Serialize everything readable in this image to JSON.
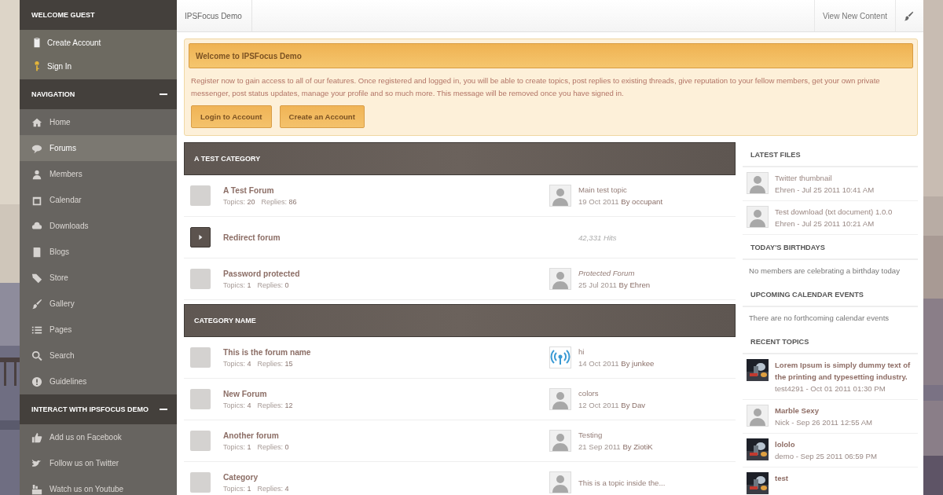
{
  "sidebar": {
    "sections": [
      {
        "title": "WELCOME GUEST",
        "items": [
          {
            "label": "Create Account",
            "selected": false
          },
          {
            "label": "Sign In",
            "selected": false
          }
        ]
      },
      {
        "title": "NAVIGATION",
        "expanded": true,
        "items": [
          {
            "label": "Home",
            "selected": false
          },
          {
            "label": "Forums",
            "selected": true
          },
          {
            "label": "Members",
            "selected": false
          },
          {
            "label": "Calendar",
            "selected": false
          },
          {
            "label": "Downloads",
            "selected": false
          },
          {
            "label": "Blogs",
            "selected": false
          },
          {
            "label": "Store",
            "selected": false
          },
          {
            "label": "Gallery",
            "selected": false
          },
          {
            "label": "Pages",
            "selected": false
          },
          {
            "label": "Search",
            "selected": false
          },
          {
            "label": "Guidelines",
            "selected": false
          }
        ]
      },
      {
        "title": "INTERACT WITH IPSFOCUS DEMO",
        "expanded": true,
        "items": [
          {
            "label": "Add us on Facebook",
            "selected": false
          },
          {
            "label": "Follow us on Twitter",
            "selected": false
          },
          {
            "label": "Watch us on Youtube",
            "selected": false
          }
        ]
      }
    ]
  },
  "top_bar": {
    "breadcrumb": "IPSFocus Demo",
    "link": "View New Content"
  },
  "notice": {
    "title": "Welcome to IPSFocus Demo",
    "text": "Register now to gain access to all of our features. Once registered and logged in, you will be able to create topics, post replies to existing threads, give reputation to your fellow members, get your own private messenger, post status updates, manage your profile and so much more. This message will be removed once you have signed in.",
    "buttons": [
      "Login to Account",
      "Create an Account"
    ]
  },
  "categories": [
    {
      "title": "A TEST CATEGORY",
      "forums": [
        {
          "kind": "forum",
          "name": "A Test Forum",
          "stats": [
            {
              "label": "Topics:",
              "value": "20"
            },
            {
              "label": "Replies:",
              "value": "86"
            }
          ],
          "last_post": {
            "kind": "normal",
            "avatar": {
              "kind": "default"
            },
            "title": "Main test topic",
            "date": "19 Oct 2011",
            "by": "By",
            "author": "occupant"
          }
        },
        {
          "kind": "redirect",
          "name": "Redirect forum",
          "hits": "42,331 Hits"
        },
        {
          "kind": "forum",
          "name": "Password protected",
          "stats": [
            {
              "label": "Topics:",
              "value": "1"
            },
            {
              "label": "Replies:",
              "value": "0"
            }
          ],
          "last_post": {
            "kind": "protected",
            "avatar": {
              "kind": "default"
            },
            "title": "Protected Forum",
            "date": "25 Jul 2011",
            "by": "By",
            "author": "Ehren"
          }
        }
      ]
    },
    {
      "title": "CATEGORY NAME",
      "forums": [
        {
          "kind": "forum",
          "name": "This is the forum name",
          "stats": [
            {
              "label": "Topics:",
              "value": "4"
            },
            {
              "label": "Replies:",
              "value": "15"
            }
          ],
          "last_post": {
            "kind": "normal",
            "avatar": {
              "kind": "broadcast"
            },
            "title": "hi",
            "date": "14 Oct 2011",
            "by": "By",
            "author": "junkee"
          }
        },
        {
          "kind": "forum",
          "name": "New Forum",
          "stats": [
            {
              "label": "Topics:",
              "value": "4"
            },
            {
              "label": "Replies:",
              "value": "12"
            }
          ],
          "last_post": {
            "kind": "normal",
            "avatar": {
              "kind": "default"
            },
            "title": "colors",
            "date": "12 Oct 2011",
            "by": "By",
            "author": "Dav"
          }
        },
        {
          "kind": "forum",
          "name": "Another forum",
          "stats": [
            {
              "label": "Topics:",
              "value": "1"
            },
            {
              "label": "Replies:",
              "value": "0"
            }
          ],
          "last_post": {
            "kind": "normal",
            "avatar": {
              "kind": "default"
            },
            "title": "Testing",
            "date": "21 Sep 2011",
            "by": "By",
            "author": "ZiotiK"
          }
        },
        {
          "kind": "forum",
          "name": "Category",
          "stats": [
            {
              "label": "Topics:",
              "value": "1"
            },
            {
              "label": "Replies:",
              "value": "4"
            }
          ],
          "last_post": {
            "kind": "normal",
            "avatar": {
              "kind": "default"
            },
            "title": "This is a topic inside the..."
          }
        }
      ]
    }
  ],
  "right_column": {
    "latest_files": {
      "title": "LATEST FILES",
      "items": [
        {
          "title": "Twitter thumbnail",
          "meta": "Ehren - Jul 25 2011 10:41 AM"
        },
        {
          "title": "Test download (txt document) 1.0.0",
          "meta": "Ehren - Jul 25 2011 10:21 AM"
        }
      ]
    },
    "birthdays": {
      "title": "TODAY'S BIRTHDAYS",
      "text": "No members are celebrating a birthday today"
    },
    "events": {
      "title": "UPCOMING CALENDAR EVENTS",
      "text": "There are no forthcoming calendar events"
    },
    "recent_topics": {
      "title": "RECENT TOPICS",
      "items": [
        {
          "title": "Lorem Ipsum is simply dummy text of the printing and typesetting industry.",
          "meta": "test4291 - Oct 01 2011 01:30 PM"
        },
        {
          "thumb": {
            "kind": "avatar"
          },
          "title": "Marble Sexy",
          "meta": "Nick - Sep 26 2011 12:55 AM"
        },
        {
          "title": "lololo",
          "meta": "demo - Sep 25 2011 06:59 PM"
        },
        {
          "title": "test"
        }
      ]
    }
  }
}
